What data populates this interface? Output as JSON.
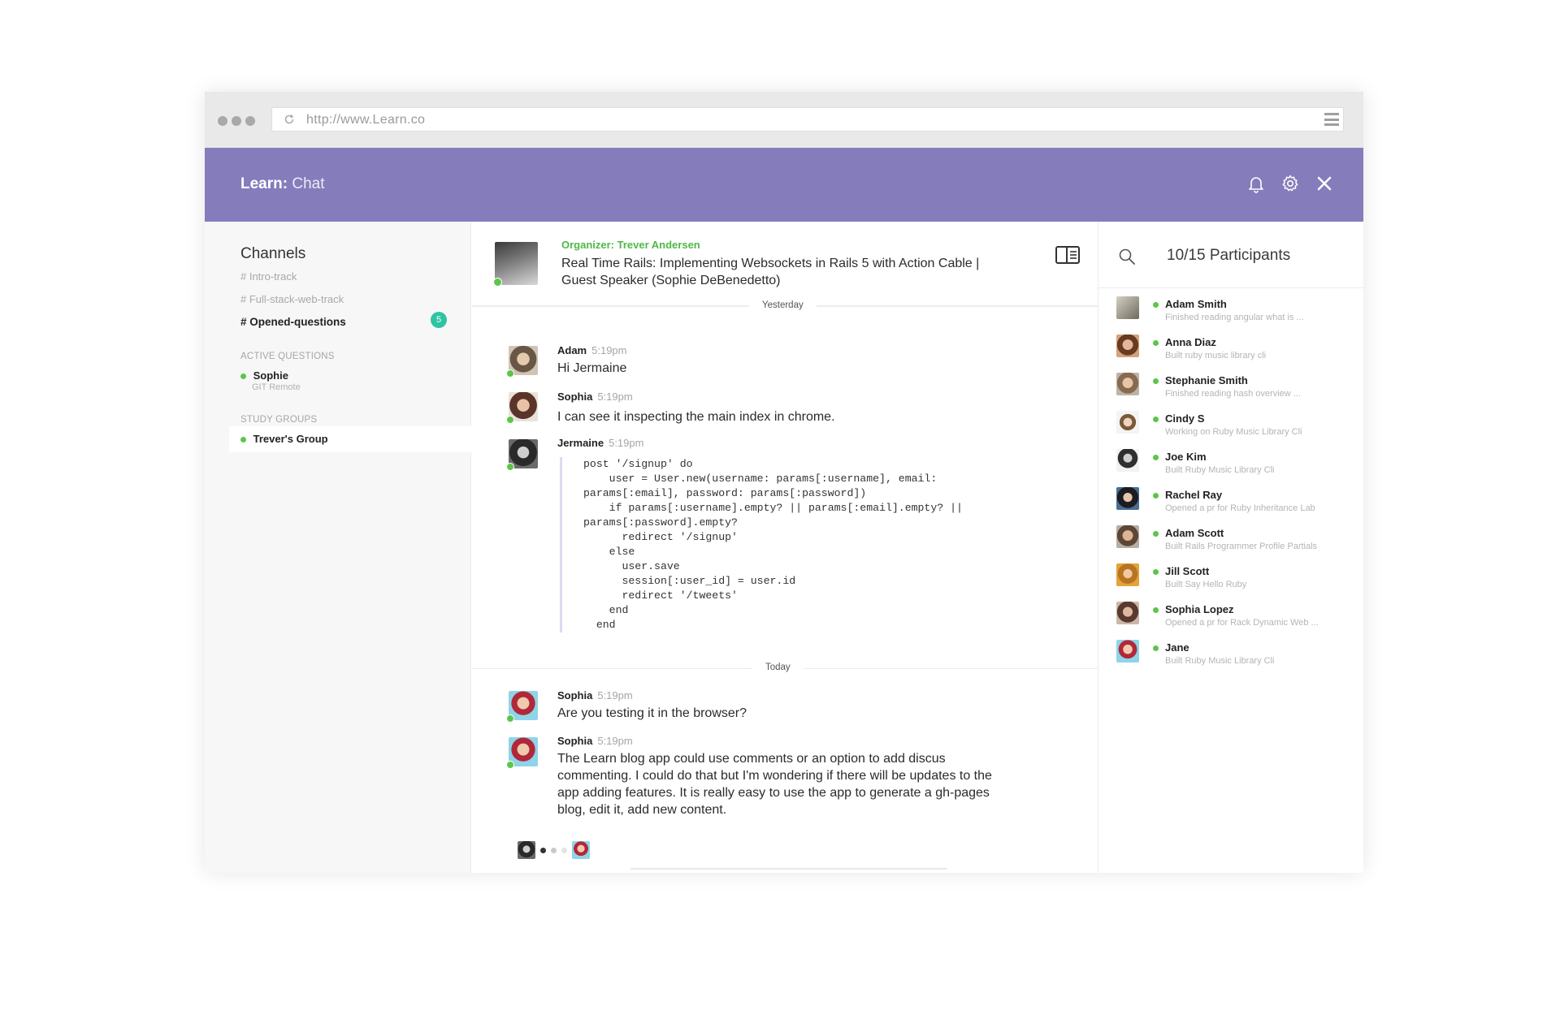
{
  "browser": {
    "url": "http://www.Learn.co"
  },
  "app": {
    "brand": "Learn:",
    "section": "Chat"
  },
  "sidebar": {
    "title": "Channels",
    "channels": [
      {
        "label": "# Intro-track"
      },
      {
        "label": "# Full-stack-web-track"
      },
      {
        "label": "# Opened-questions",
        "badge": "5"
      }
    ],
    "active_questions_label": "ACTIVE QUESTIONS",
    "active_questions": [
      {
        "name": "Sophie",
        "sub": "GIT Remote"
      }
    ],
    "study_groups_label": "STUDY GROUPS",
    "study_groups": [
      {
        "name": "Trever's Group"
      }
    ]
  },
  "chat": {
    "organizer": "Organizer: Trever Andersen",
    "topic": "Real Time Rails: Implementing Websockets in Rails 5 with Action Cable  |  Guest Speaker (Sophie DeBenedetto)",
    "yesterday_label": "Yesterday",
    "today_label": "Today",
    "messages": [
      {
        "author": "Adam",
        "time": "5:19pm",
        "text": "Hi Jermaine"
      },
      {
        "author": "Sophia",
        "time": "5:19pm",
        "text": "I can see it inspecting the main index in chrome."
      },
      {
        "author": "Jermaine",
        "time": "5:19pm",
        "code": "post '/signup' do\n    user = User.new(username: params[:username], email:\nparams[:email], password: params[:password])\n    if params[:username].empty? || params[:email].empty? ||\nparams[:password].empty?\n      redirect '/signup'\n    else\n      user.save\n      session[:user_id] = user.id\n      redirect '/tweets'\n    end\n  end"
      },
      {
        "author": "Sophia",
        "time": "5:19pm",
        "text": "Are you testing it in the browser?"
      },
      {
        "author": "Sophia",
        "time": "5:19pm",
        "text": "The Learn blog app could use comments or an option to add discus commenting. I could do that but I'm wondering if there will be updates to the app adding features. It is really easy to use the app to generate a gh-pages blog, edit it, add new content."
      }
    ]
  },
  "participants": {
    "count_label": "10/15 Participants",
    "list": [
      {
        "name": "Adam Smith",
        "status": "Finished reading angular what is ..."
      },
      {
        "name": "Anna Diaz",
        "status": "Built ruby music library cli"
      },
      {
        "name": "Stephanie Smith",
        "status": "Finished reading hash overview ..."
      },
      {
        "name": "Cindy S",
        "status": "Working on Ruby Music Library Cli"
      },
      {
        "name": "Joe Kim",
        "status": "Built Ruby Music Library Cli"
      },
      {
        "name": "Rachel Ray",
        "status": "Opened a pr for Ruby Inheritance Lab"
      },
      {
        "name": "Adam Scott",
        "status": "Built Rails Programmer Profile Partials"
      },
      {
        "name": "Jill Scott",
        "status": "Built Say Hello Ruby"
      },
      {
        "name": "Sophia Lopez",
        "status": "Opened a pr for Rack Dynamic Web ..."
      },
      {
        "name": "Jane",
        "status": "Built Ruby Music Library Cli"
      }
    ]
  },
  "icons": {
    "bell": "bell-icon",
    "settings": "gear-icon",
    "close": "close-icon",
    "search": "search-icon",
    "panel_toggle": "sidebar-toggle-icon"
  },
  "colors": {
    "header": "#857cbb",
    "online": "#5cc64a",
    "organizer": "#4fb847",
    "badge": "#2ec4a4"
  }
}
